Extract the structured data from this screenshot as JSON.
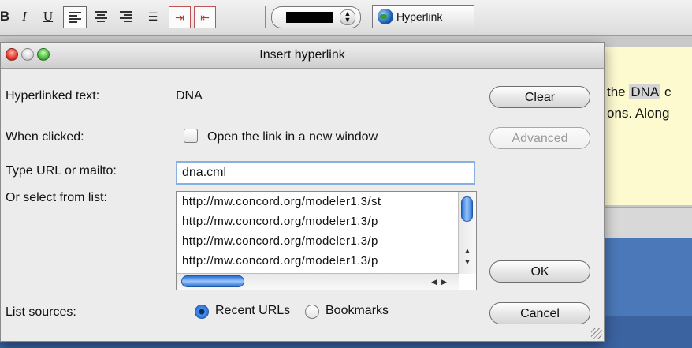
{
  "toolbar": {
    "bold_label": "B",
    "italic_label": "I",
    "underline_label": "U",
    "hyperlink_label": "Hyperlink",
    "color_value": "#000000"
  },
  "background_document": {
    "line1_prefix": "the ",
    "line1_highlight": "DNA",
    "line1_suffix": " c",
    "line2": "ons. Along"
  },
  "dialog": {
    "title": "Insert hyperlink",
    "hyperlinked_text_label": "Hyperlinked text:",
    "hyperlinked_text_value": "DNA",
    "when_clicked_label": "When clicked:",
    "new_window_label": "Open the link in a new window",
    "new_window_checked": false,
    "url_label": "Type URL or mailto:",
    "url_value": "dna.cml",
    "list_label": "Or select from list:",
    "list_items": [
      "http://mw.concord.org/modeler1.3/st",
      "http://mw.concord.org/modeler1.3/p",
      "http://mw.concord.org/modeler1.3/p",
      "http://mw.concord.org/modeler1.3/p"
    ],
    "list_sources_label": "List sources:",
    "source_recent_label": "Recent URLs",
    "source_bookmarks_label": "Bookmarks",
    "selected_source": "Recent URLs",
    "buttons": {
      "clear": "Clear",
      "advanced": "Advanced",
      "ok": "OK",
      "cancel": "Cancel"
    }
  }
}
